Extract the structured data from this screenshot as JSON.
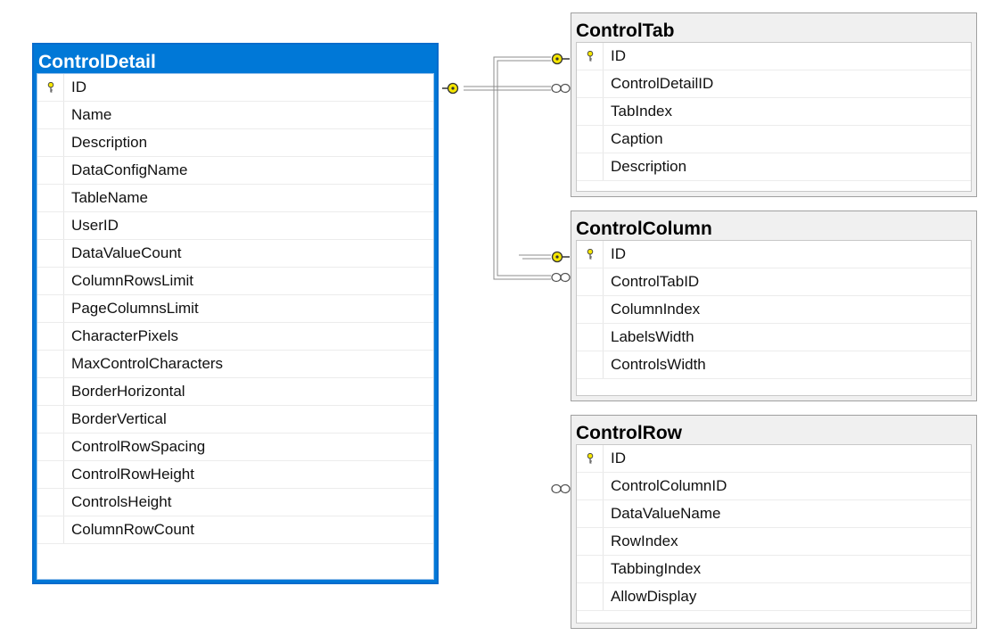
{
  "tables": {
    "detail": {
      "title": "ControlDetail",
      "columns": [
        {
          "name": "ID",
          "pk": true
        },
        {
          "name": "Name"
        },
        {
          "name": "Description"
        },
        {
          "name": "DataConfigName"
        },
        {
          "name": "TableName"
        },
        {
          "name": "UserID"
        },
        {
          "name": "DataValueCount"
        },
        {
          "name": "ColumnRowsLimit"
        },
        {
          "name": "PageColumnsLimit"
        },
        {
          "name": "CharacterPixels"
        },
        {
          "name": "MaxControlCharacters"
        },
        {
          "name": "BorderHorizontal"
        },
        {
          "name": "BorderVertical"
        },
        {
          "name": "ControlRowSpacing"
        },
        {
          "name": "ControlRowHeight"
        },
        {
          "name": "ControlsHeight"
        },
        {
          "name": "ColumnRowCount"
        }
      ]
    },
    "tab": {
      "title": "ControlTab",
      "columns": [
        {
          "name": "ID",
          "pk": true
        },
        {
          "name": "ControlDetailID"
        },
        {
          "name": "TabIndex"
        },
        {
          "name": "Caption"
        },
        {
          "name": "Description"
        }
      ]
    },
    "column": {
      "title": "ControlColumn",
      "columns": [
        {
          "name": "ID",
          "pk": true
        },
        {
          "name": "ControlTabID"
        },
        {
          "name": "ColumnIndex"
        },
        {
          "name": "LabelsWidth"
        },
        {
          "name": "ControlsWidth"
        }
      ]
    },
    "row": {
      "title": "ControlRow",
      "columns": [
        {
          "name": "ID",
          "pk": true
        },
        {
          "name": "ControlColumnID"
        },
        {
          "name": "DataValueName"
        },
        {
          "name": "RowIndex"
        },
        {
          "name": "TabbingIndex"
        },
        {
          "name": "AllowDisplay"
        }
      ]
    }
  },
  "colors": {
    "selected_header": "#0078d7",
    "key_icon": "#f5e600",
    "connector": "#8c8c8c"
  }
}
